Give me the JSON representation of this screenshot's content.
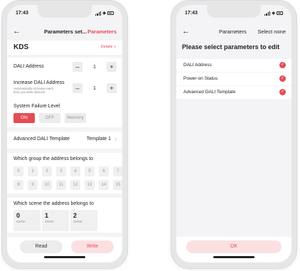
{
  "left": {
    "time": "17:43",
    "nav_title": "Parameters set...",
    "nav_action": "Parameters",
    "device_name": "KDS",
    "details_label": "Details",
    "dali_address": {
      "label": "DALI Address",
      "value": "1"
    },
    "increase_address": {
      "label": "Increase DALI Address",
      "hint_line1": "Automatically increase each",
      "hint_line2": "time you write devices",
      "value": "1"
    },
    "system_failure": {
      "label": "System Failure Level",
      "options": [
        "ON",
        "OFF",
        "Memory"
      ],
      "selected": "ON"
    },
    "template": {
      "label": "Advanced DALI Template",
      "value": "Template 1"
    },
    "group_section": {
      "label": "Which group the address belongs to",
      "items": [
        "0",
        "1",
        "2",
        "3",
        "4",
        "5",
        "6",
        "7",
        "8",
        "9",
        "10",
        "11",
        "12",
        "13",
        "14",
        "15"
      ]
    },
    "scene_section": {
      "label": "Which scene the address belongs to",
      "scenes": [
        {
          "num": "0",
          "kelvin": "6500K"
        },
        {
          "num": "1",
          "kelvin": "2500K"
        },
        {
          "num": "2",
          "kelvin": "2500K"
        }
      ]
    },
    "read_label": "Read",
    "write_label": "Write"
  },
  "right": {
    "time": "17:43",
    "nav_title": "Parameters",
    "nav_action": "Select none",
    "heading": "Please select parameters to edit",
    "items": [
      "DALI Address",
      "Power-on Status",
      "Advanced DALI Template"
    ],
    "ok_label": "OK"
  },
  "colors": {
    "accent": "#e44c54",
    "accent_light": "#fbe0e2"
  }
}
